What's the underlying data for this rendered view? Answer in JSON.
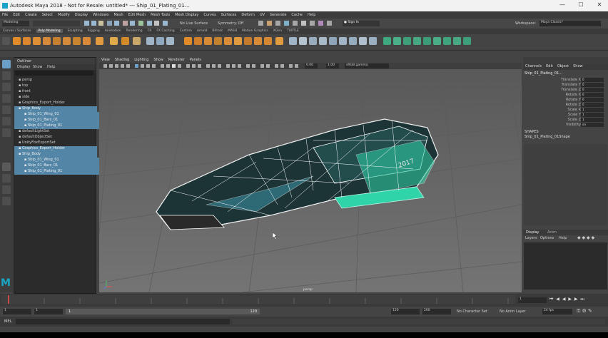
{
  "window": {
    "title": "Autodesk Maya 2018 - Not for Resale: untitled*  ---  Ship_01_Plating_01...",
    "controls": {
      "minimize": "—",
      "maximize": "☐",
      "close": "✕"
    }
  },
  "menubar": [
    "File",
    "Edit",
    "Create",
    "Select",
    "Modify",
    "Display",
    "Windows",
    "Mesh",
    "Edit Mesh",
    "Mesh Tools",
    "Mesh Display",
    "Curves",
    "Surfaces",
    "Deform",
    "UV",
    "Generate",
    "Cache",
    "Help"
  ],
  "statusline": {
    "mode": "Modeling",
    "live_surface": "No Live Surface",
    "symmetry": "Symmetry: Off",
    "sign_in": "Sign In",
    "workspace_label": "Workspace:",
    "workspace": "Maya Classic*"
  },
  "shelf": {
    "tabs": [
      "Curves / Surfaces",
      "Poly Modeling",
      "Sculpting",
      "Rigging",
      "Animation",
      "Rendering",
      "FX",
      "FX Caching",
      "Custom",
      "Arnold",
      "Bifrost",
      "MASH",
      "Motion Graphics",
      "XGen",
      "TURTLE"
    ],
    "active_tab": "Poly Modeling"
  },
  "outliner": {
    "title": "Outliner",
    "menu": [
      "Display",
      "Show",
      "Help"
    ],
    "items": [
      {
        "label": "persp",
        "selected": false
      },
      {
        "label": "top",
        "selected": false
      },
      {
        "label": "front",
        "selected": false
      },
      {
        "label": "side",
        "selected": false
      },
      {
        "label": "Graphics_Export_Holder",
        "selected": false
      },
      {
        "label": "Ship_Body",
        "selected": true
      },
      {
        "label": "Ship_01_Wing_01",
        "selected": true
      },
      {
        "label": "Ship_01_Bars_01",
        "selected": true
      },
      {
        "label": "Ship_01_Plating_01",
        "selected": true
      },
      {
        "label": "defaultLightSet",
        "selected": false
      },
      {
        "label": "defaultObjectSet",
        "selected": false
      },
      {
        "label": "UnityFbxExportSet",
        "selected": false
      },
      {
        "label": "Graphics_Export_Holder",
        "selected": true
      },
      {
        "label": "Ship_Body",
        "selected": true
      },
      {
        "label": "Ship_01_Wing_01",
        "selected": true
      },
      {
        "label": "Ship_01_Bars_01",
        "selected": true
      },
      {
        "label": "Ship_01_Plating_01",
        "selected": true
      }
    ]
  },
  "viewport": {
    "menu": [
      "View",
      "Shading",
      "Lighting",
      "Show",
      "Renderer",
      "Panels"
    ],
    "field_a": "0.00",
    "field_b": "1.00",
    "color_space": "sRGB gamma",
    "camera_label": "persp",
    "decal_text": "2017"
  },
  "channel_box": {
    "menu": [
      "Channels",
      "Edit",
      "Object",
      "Show"
    ],
    "object": "Ship_01_Plating_01...",
    "attributes": [
      {
        "label": "Translate X",
        "value": "0"
      },
      {
        "label": "Translate Y",
        "value": "0"
      },
      {
        "label": "Translate Z",
        "value": "0"
      },
      {
        "label": "Rotate X",
        "value": "0"
      },
      {
        "label": "Rotate Y",
        "value": "0"
      },
      {
        "label": "Rotate Z",
        "value": "0"
      },
      {
        "label": "Scale X",
        "value": "1"
      },
      {
        "label": "Scale Y",
        "value": "1"
      },
      {
        "label": "Scale Z",
        "value": "1"
      },
      {
        "label": "Visibility",
        "value": "on"
      }
    ],
    "shapes_label": "SHAPES",
    "shape": "Ship_01_Plating_01Shape"
  },
  "layer_editor": {
    "tabs": [
      "Display",
      "Anim"
    ],
    "menu": [
      "Layers",
      "Options",
      "Help"
    ]
  },
  "timeline": {
    "current_frame": "1",
    "range_start": "1",
    "range_start_inner": "1",
    "range_end_inner": "120",
    "range_end": "120",
    "anim_end": "200",
    "character_set": "No Character Set",
    "anim_layer": "No Anim Layer",
    "fps": "24 fps"
  },
  "cmdline": {
    "label": "MEL"
  },
  "colors": {
    "selection": "#5285a6",
    "maya_logo": "#19a6c4",
    "mesh_teal": "#2fd4a8"
  }
}
